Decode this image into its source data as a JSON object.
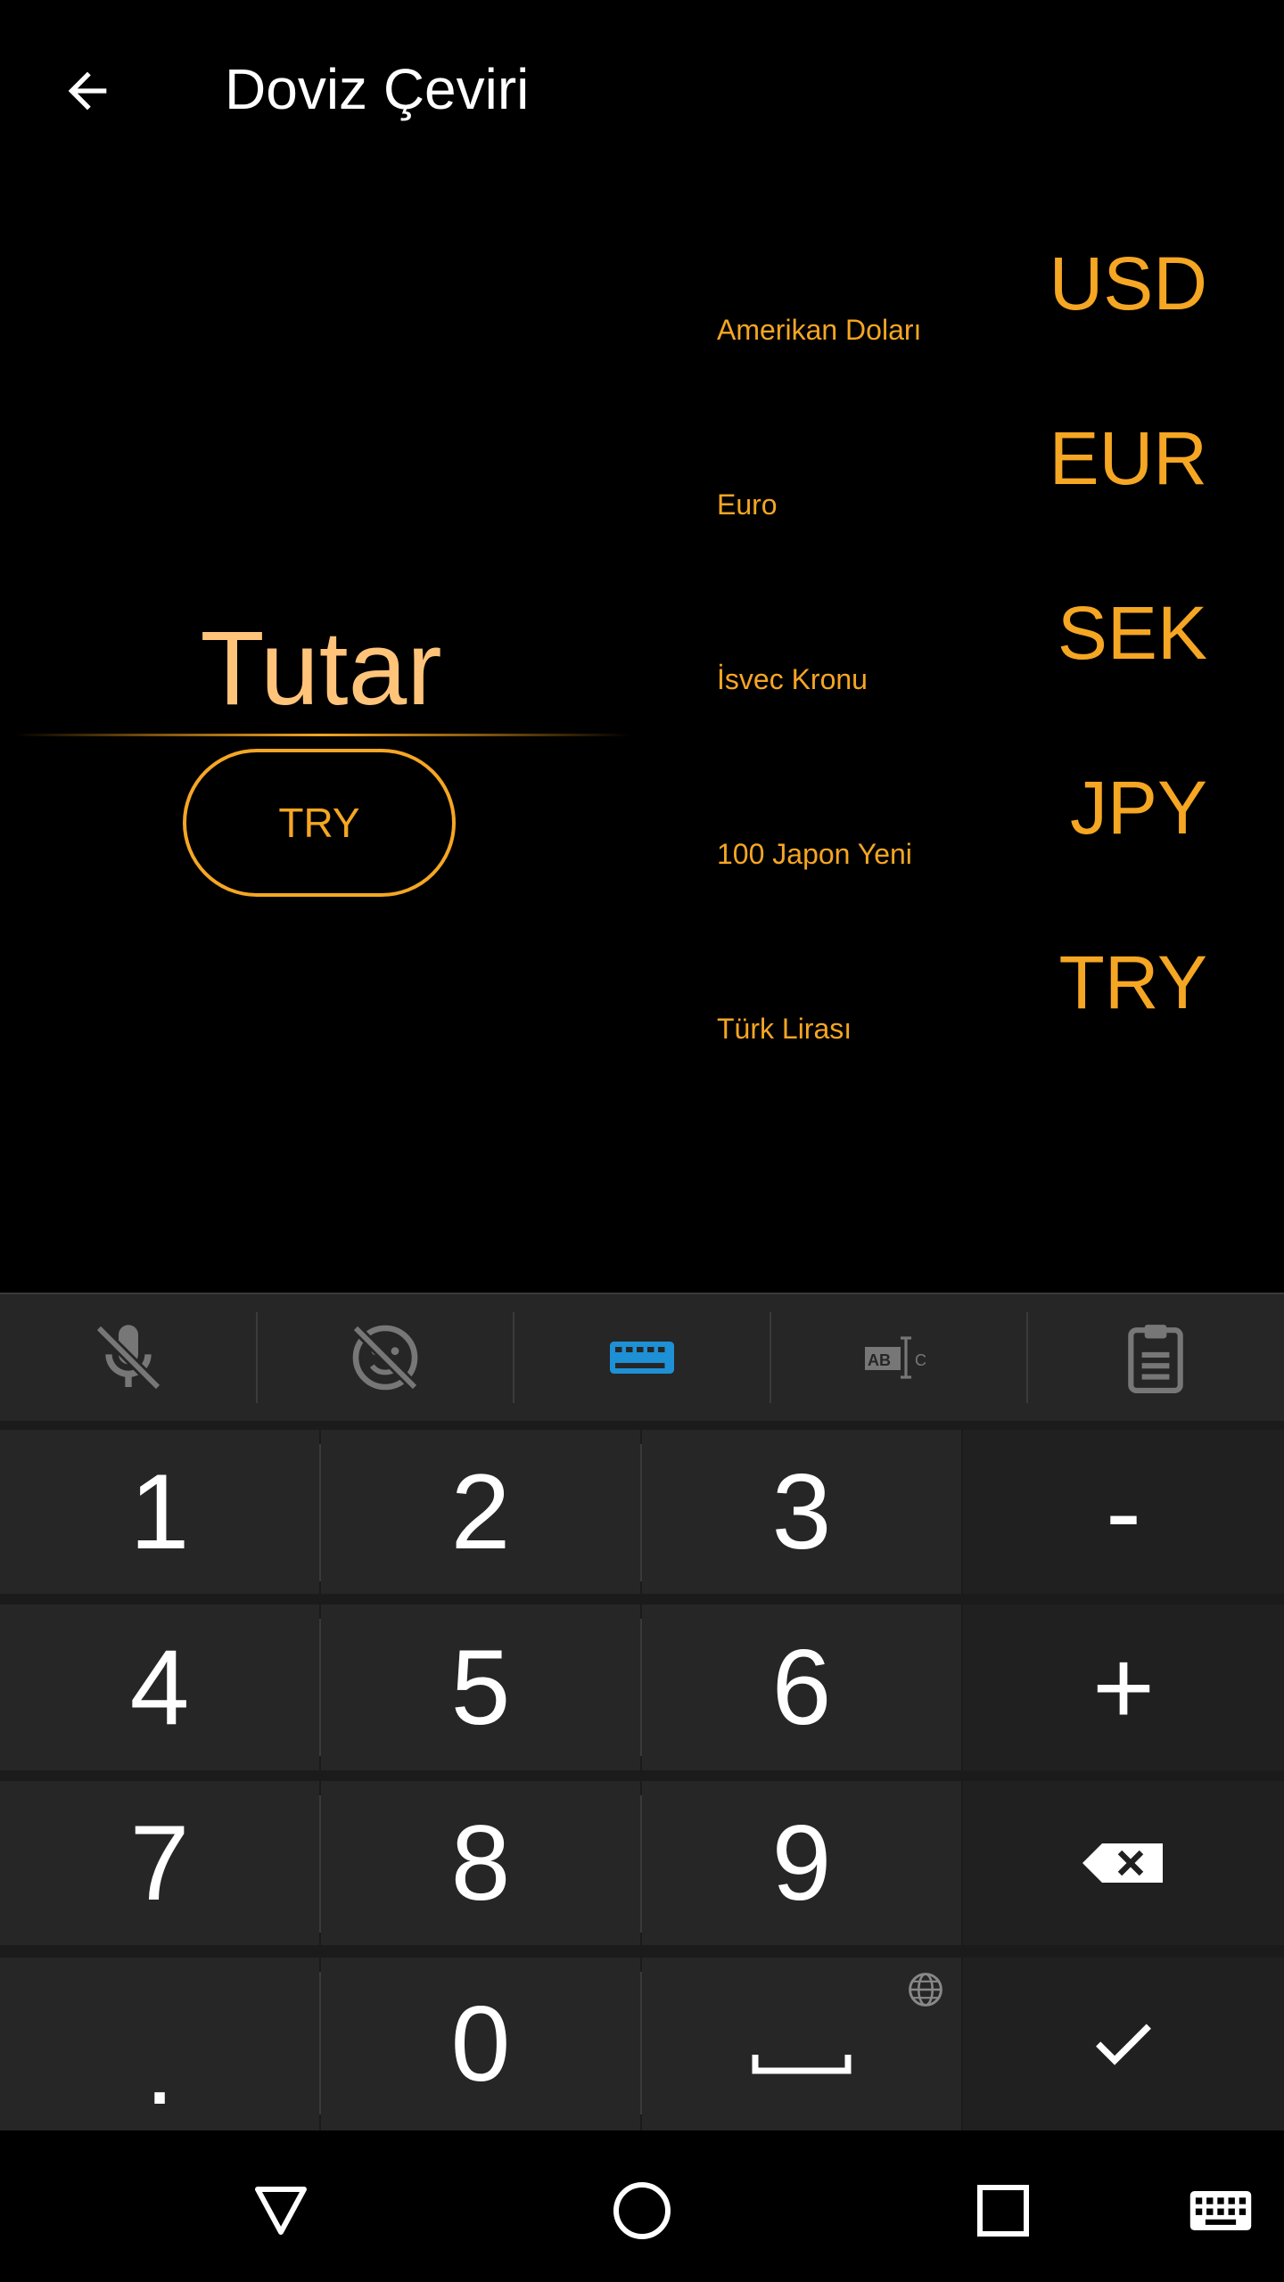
{
  "app_bar": {
    "title": "Doviz Çeviri",
    "back_icon": "arrow-back-icon"
  },
  "input": {
    "amount_placeholder": "Tutar",
    "currency_button": "TRY"
  },
  "currencies": [
    {
      "code": "USD",
      "name": "Amerikan Doları"
    },
    {
      "code": "EUR",
      "name": "Euro"
    },
    {
      "code": "SEK",
      "name": "İsvec Kronu"
    },
    {
      "code": "JPY",
      "name": "100 Japon Yeni"
    },
    {
      "code": "TRY",
      "name": "Türk Lirası"
    }
  ],
  "keyboard": {
    "toolbar": [
      "mic-off-icon",
      "emoji-off-icon",
      "keyboard-icon",
      "text-select-icon",
      "clipboard-icon"
    ],
    "keys": {
      "k1": "1",
      "k2": "2",
      "k3": "3",
      "minus": "-",
      "k4": "4",
      "k5": "5",
      "k6": "6",
      "plus": "+",
      "k7": "7",
      "k8": "8",
      "k9": "9",
      "dot": ".",
      "k0": "0"
    }
  },
  "colors": {
    "accent": "#F5A623",
    "placeholder": "#FFC47A",
    "keyboard_bg": "#1b1b1b",
    "key_bg": "#262626",
    "active_tool": "#1E90D6"
  }
}
